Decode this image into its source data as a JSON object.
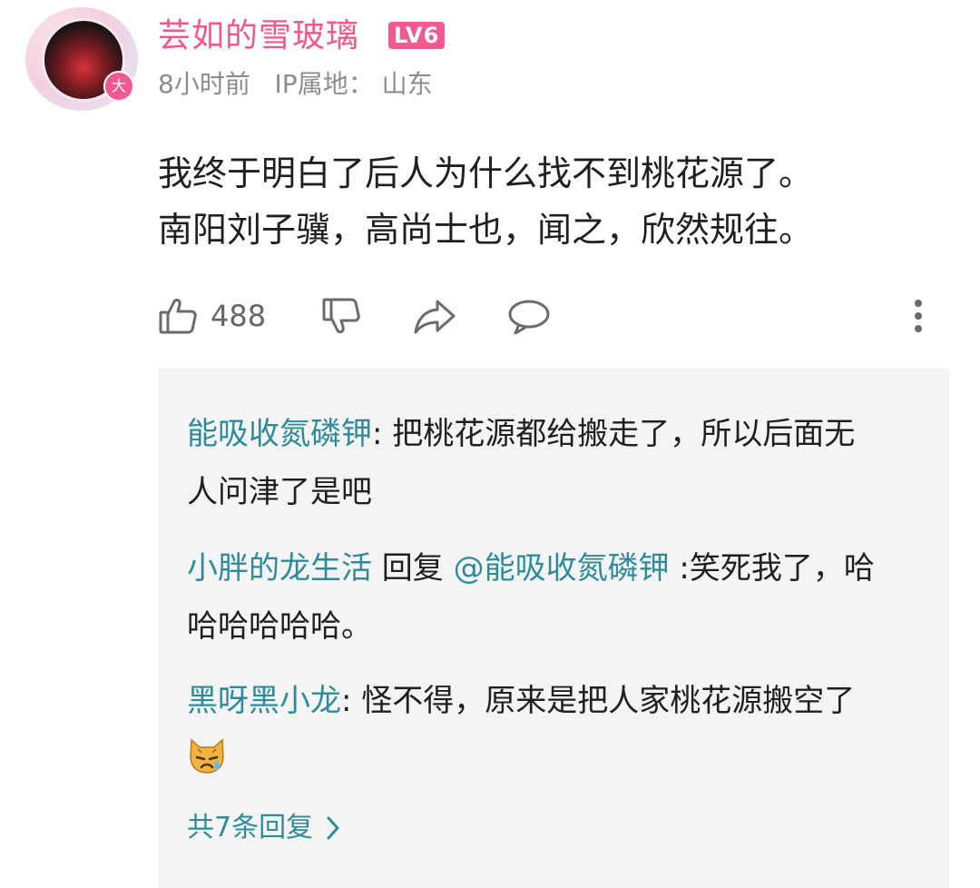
{
  "post": {
    "author": "芸如的雪玻璃",
    "level": "LV6",
    "avatar_badge": "大",
    "time": "8小时前",
    "ip_label": "IP属地：",
    "ip_location": "山东",
    "content_line1": "我终于明白了后人为什么找不到桃花源了。",
    "content_line2": "南阳刘子骥，高尚士也，闻之，欣然规往。",
    "like_count": "488",
    "icons": [
      "thumbs-up-icon",
      "thumbs-down-icon",
      "share-icon",
      "comment-icon",
      "more-dots-icon"
    ]
  },
  "replies": [
    {
      "user": "能吸收氮磷钾",
      "text": ": 把桃花源都给搬走了，所以后面无人问津了是吧"
    },
    {
      "user": "小胖的龙生活",
      "reply_word": " 回复 ",
      "mention": "@能吸收氮磷钾",
      "text": " :笑死我了，哈哈哈哈哈哈。"
    },
    {
      "user": "黑呀黑小龙",
      "text": ": 怪不得，原来是把人家桃花源搬空了",
      "emoji": "crying-cat-icon"
    }
  ],
  "more_replies_label": "共7条回复",
  "colors": {
    "author": "#ef5a88",
    "level_badge": "#f05a8f",
    "reply_user": "#2e8c9a",
    "panel_bg": "#f4f4f4",
    "meta": "#8c8c8c"
  }
}
